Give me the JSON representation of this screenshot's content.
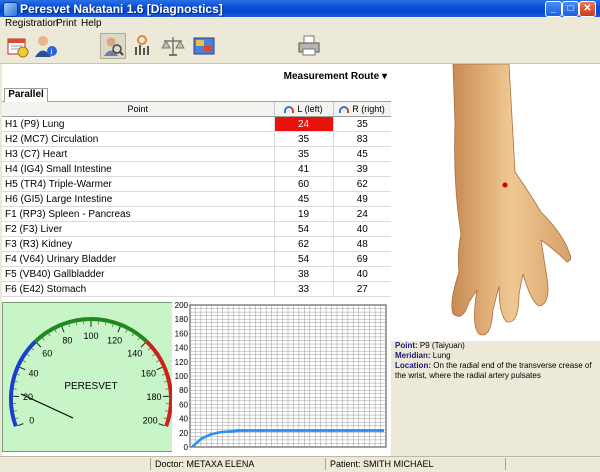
{
  "window": {
    "title": "Peresvet Nakatani 1.6 [Diagnostics]"
  },
  "menu": [
    "Registration",
    "Print",
    "Help"
  ],
  "toolbar": {
    "buttons": [
      {
        "name": "calendar-icon"
      },
      {
        "name": "patient-info-icon"
      },
      {
        "name": "diagnostics-icon"
      },
      {
        "name": "chart-icon"
      },
      {
        "name": "scales-icon"
      },
      {
        "name": "map-icon"
      },
      {
        "name": "printer-icon"
      }
    ]
  },
  "measurement_route": "Measurement Route",
  "tab": "Parallel",
  "table": {
    "headers": {
      "point": "Point",
      "left": "L (left)",
      "right": "R (right)"
    },
    "rows": [
      {
        "point": "H1  (P9)  Lung",
        "left": "24",
        "right": "35",
        "highlight": true
      },
      {
        "point": "H2  (MC7)  Circulation",
        "left": "35",
        "right": "83"
      },
      {
        "point": "H3  (C7)  Heart",
        "left": "35",
        "right": "45"
      },
      {
        "point": "H4  (IG4)  Small Intestine",
        "left": "41",
        "right": "39"
      },
      {
        "point": "H5  (TR4)  Triple-Warmer",
        "left": "60",
        "right": "62"
      },
      {
        "point": "H6  (GI5)  Large Intestine",
        "left": "45",
        "right": "49"
      },
      {
        "point": "F1  (RP3)  Spleen - Pancreas",
        "left": "19",
        "right": "24"
      },
      {
        "point": "F2  (F3)  Liver",
        "left": "54",
        "right": "40"
      },
      {
        "point": "F3  (R3)  Kidney",
        "left": "62",
        "right": "48"
      },
      {
        "point": "F4  (V64)  Urinary Bladder",
        "left": "54",
        "right": "69"
      },
      {
        "point": "F5  (VB40)  Gallbladder",
        "left": "38",
        "right": "40"
      },
      {
        "point": "F6  (E42)  Stomach",
        "left": "33",
        "right": "27"
      }
    ]
  },
  "gauge": {
    "label": "PERESVET",
    "ticks": [
      "0",
      "20",
      "40",
      "60",
      "80",
      "100",
      "120",
      "140",
      "160",
      "180",
      "200"
    ],
    "needle_value": 0
  },
  "graph": {
    "y_ticks": [
      "200",
      "180",
      "160",
      "140",
      "120",
      "100",
      "80",
      "60",
      "40",
      "20",
      "0"
    ],
    "ymax": 200,
    "line": [
      0,
      12,
      18,
      21,
      22,
      23,
      23,
      23,
      23,
      23,
      23,
      23,
      23,
      23,
      23,
      23,
      23,
      23,
      23,
      23,
      23
    ]
  },
  "info": {
    "point_label": "Point:",
    "point_value": "P9 (Taiyuan)",
    "meridian_label": "Meridian:",
    "meridian_value": "Lung",
    "location_label": "Location:",
    "location_value": "On the radial end of the transverse crease of the wrist, where the radial artery pulsates"
  },
  "status": {
    "doctor": "Doctor: METAXA ELENA",
    "patient": "Patient: SMITH MICHAEL"
  },
  "colors": {
    "highlight": "#e8120c",
    "gauge_bg": "#c8f5c8",
    "graph_line": "#2a8ef0"
  }
}
